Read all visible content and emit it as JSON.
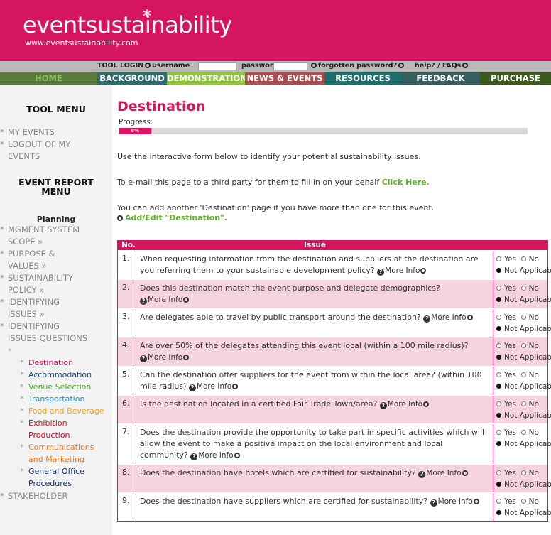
{
  "brand": {
    "logo": "eventsustainability",
    "url": "www.eventsustainability.com"
  },
  "login": {
    "tool_login": "TOOL LOGIN",
    "username_label": "username",
    "password_label": "password",
    "forgotten": "forgotten password?",
    "help": "help? / FAQs"
  },
  "nav": [
    {
      "label": "HOME",
      "bg": "#5a7a3c",
      "color": "#8fbf58"
    },
    {
      "label": "BACKGROUND",
      "bg": "#2e6b6b",
      "color": "#ffffff"
    },
    {
      "label": "DEMONSTRATION",
      "bg": "#8dc63f",
      "color": "#ffffff"
    },
    {
      "label": "NEWS & EVENTS",
      "bg": "#a9504e",
      "color": "#ffffff"
    },
    {
      "label": "RESOURCES",
      "bg": "#1f6e6e",
      "color": "#ffffff"
    },
    {
      "label": "FEEDBACK",
      "bg": "#355f5f",
      "color": "#ffffff"
    },
    {
      "label": "PURCHASE",
      "bg": "#3a5a1e",
      "color": "#ffffff"
    }
  ],
  "sidebar": {
    "tool_menu": "TOOL MENU",
    "my_events": "MY EVENTS",
    "logout_1": "LOGOUT OF MY",
    "logout_2": "EVENTS",
    "report_menu_1": "EVENT REPORT",
    "report_menu_2": "MENU",
    "planning": "Planning",
    "links": [
      "MGMENT SYSTEM",
      "SCOPE »",
      "PURPOSE &",
      "VALUES »",
      "SUSTAINABILITY",
      "POLICY »",
      "IDENTIFYING",
      "ISSUES »",
      "IDENTIFYING",
      "ISSUES QUESTIONS",
      "»"
    ],
    "issues": [
      {
        "label": "Destination",
        "color": "#d6155f"
      },
      {
        "label": "Accommodation",
        "color": "#1d4f7a"
      },
      {
        "label": "Venue Selection",
        "color": "#4aa82a"
      },
      {
        "label": "Transportation",
        "color": "#1b8fc7"
      },
      {
        "label": "Food and Beverage",
        "color": "#f0a11a"
      },
      {
        "label": "Exhibition",
        "color": "#c0182a"
      },
      {
        "label": "Production",
        "color": "#c0182a"
      },
      {
        "label": "Communications",
        "color": "#f07a1a"
      },
      {
        "label": "and Marketing",
        "color": "#f07a1a"
      },
      {
        "label": "General Office",
        "color": "#1b2f7a"
      },
      {
        "label": "Procedures",
        "color": "#1b2f7a"
      }
    ],
    "stakeholder": "STAKEHOLDER"
  },
  "main": {
    "title": "Destination",
    "progress_label": "Progress:",
    "progress_percent": "8%",
    "progress_value": 0.08,
    "intro": "Use the interactive form below to identify your potential sustainability issues.",
    "email_text": "To e-mail this page to a third party for them to fill in on your behalf",
    "email_link": "Click Here.",
    "add_text": "You can add another 'Destination' page if you have more than one for this event.",
    "add_link": "Add/Edit \"Destination\"."
  },
  "table": {
    "col_no": "No.",
    "col_issue": "Issue",
    "more_info": "More Info",
    "yes": "Yes",
    "no": "No",
    "na": "Not Applicable",
    "rows": [
      {
        "no": "1.",
        "text": "When requesting information from the destination and suppliers at the destination are you referring them to your sustainable development policy?"
      },
      {
        "no": "2.",
        "text": "Does this destination match the event purpose and delegate demographics?"
      },
      {
        "no": "3.",
        "text": "Are delegates able to travel by public transport around the destination?"
      },
      {
        "no": "4.",
        "text": "Are over 50% of the delegates attending this event local (within a 100 mile radius)?"
      },
      {
        "no": "5.",
        "text": "Can the destination offer suppliers for the event from within the local area? (within 100 mile radius)"
      },
      {
        "no": "6.",
        "text": "Is the destination located in a certified Fair Trade Town/area?"
      },
      {
        "no": "7.",
        "text": "Does the destination provide the opportunity to take part in specific activities which will allow the event to make a positive impact on the local environment and local community?"
      },
      {
        "no": "8.",
        "text": "Does the destination have hotels which are certified for sustainability?"
      },
      {
        "no": "9.",
        "text": "Does the destination have suppliers which are certified for sustainability?"
      }
    ]
  }
}
